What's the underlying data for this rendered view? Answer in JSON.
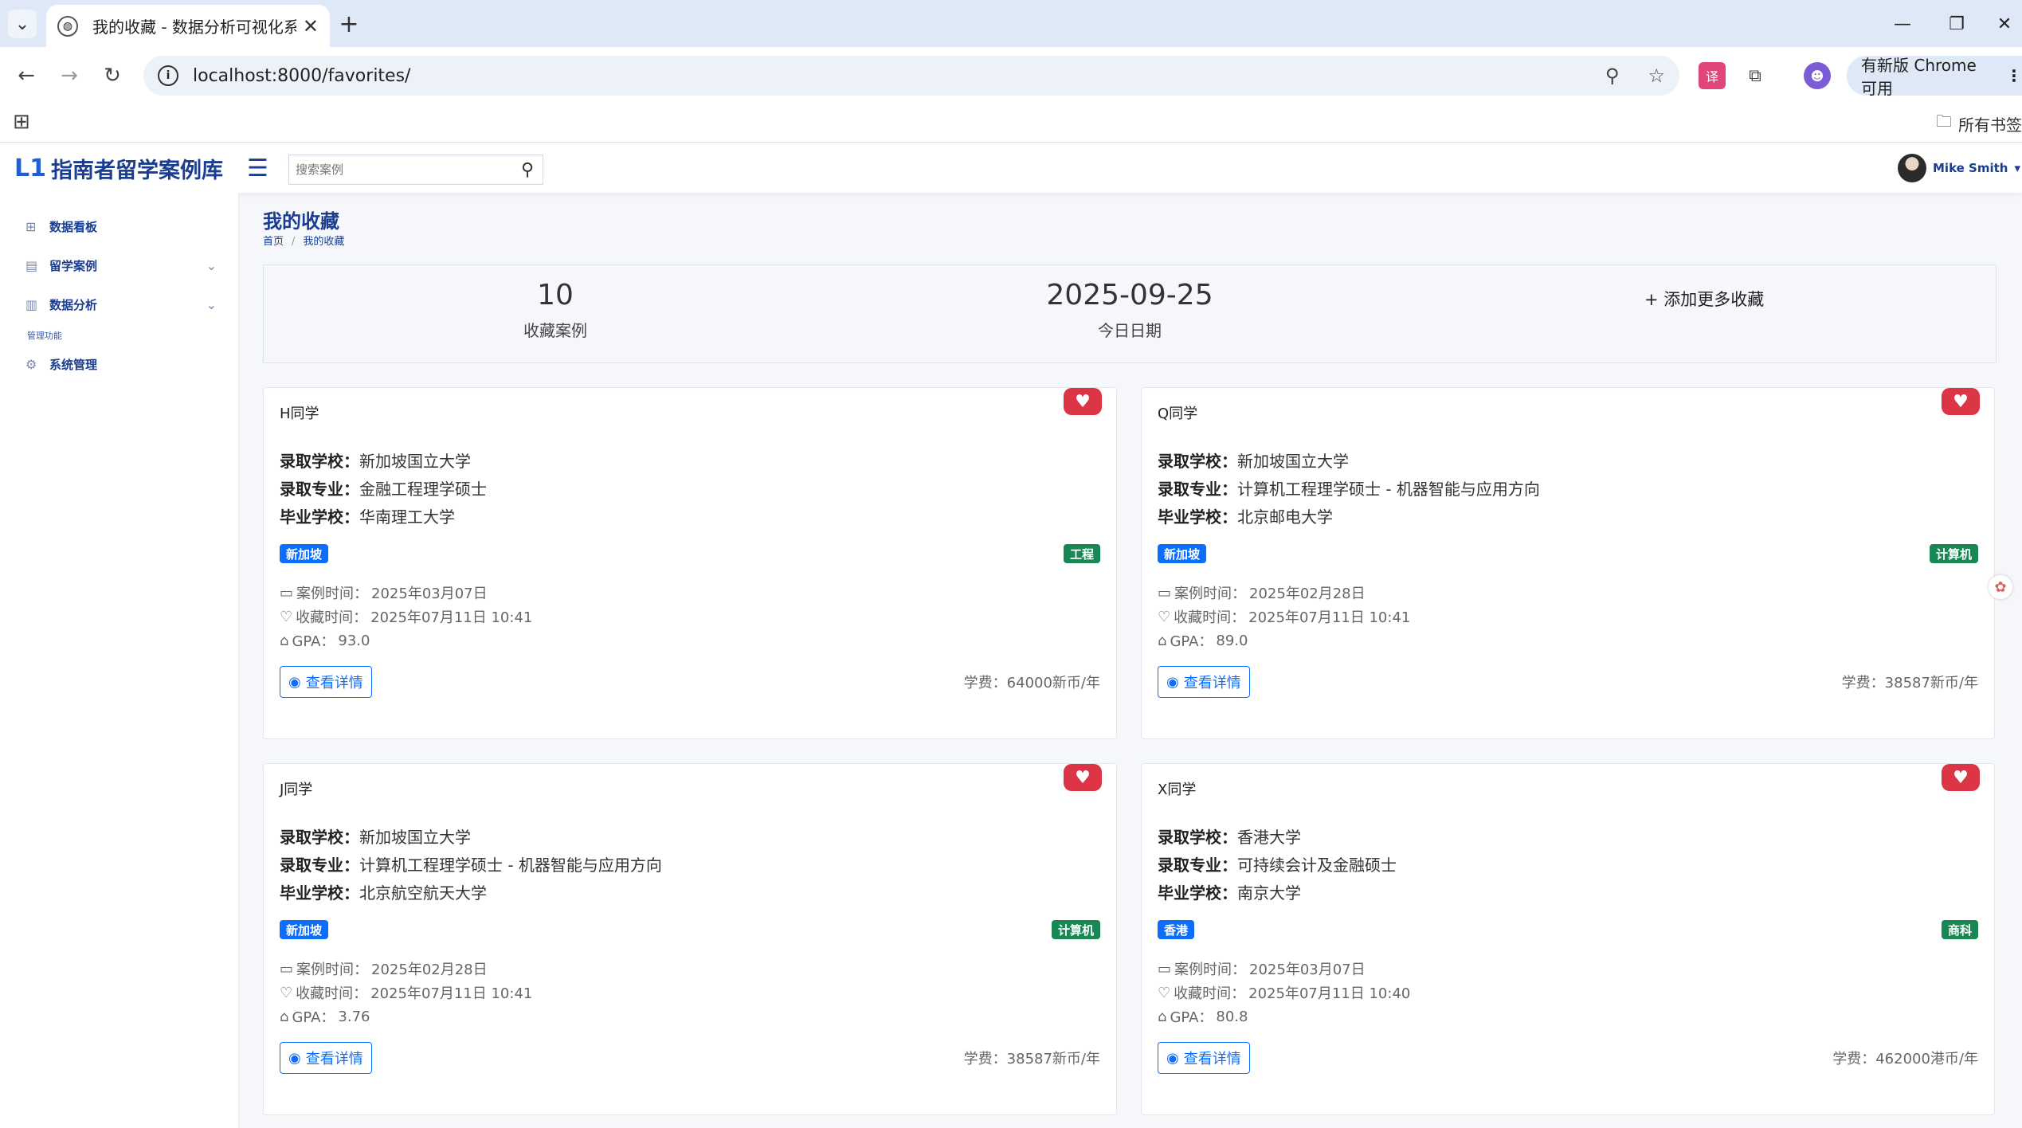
{
  "browser": {
    "tab_title": "我的收藏 - 数据分析可视化系统",
    "url": "localhost:8000/favorites/",
    "update_label": "有新版 Chrome 可用",
    "all_bookmarks": "所有书签"
  },
  "header": {
    "logo_mark": "L1",
    "logo_text": "指南者留学案例库",
    "search_placeholder": "搜索案例",
    "user_name": "Mike Smith",
    "user_caret": "▾"
  },
  "sidebar": {
    "items": [
      {
        "label": "数据看板",
        "icon": "dashboard-icon"
      },
      {
        "label": "留学案例",
        "icon": "document-icon",
        "chevron": "⌄"
      },
      {
        "label": "数据分析",
        "icon": "bar-chart-icon",
        "chevron": "⌄"
      }
    ],
    "category": "管理功能",
    "admin_item": {
      "label": "系统管理",
      "icon": "gear-icon"
    }
  },
  "page": {
    "title": "我的收藏",
    "breadcrumb_home": "首页",
    "breadcrumb_sep": "/",
    "breadcrumb_current": "我的收藏"
  },
  "stats": {
    "count_value": "10",
    "count_label": "收藏案例",
    "date_value": "2025-09-25",
    "date_label": "今日日期",
    "add_more": "+ 添加更多收藏"
  },
  "labels": {
    "school": "录取学校：",
    "major": "录取专业：",
    "grad": "毕业学校：",
    "case_time": "案例时间：",
    "fav_time": "收藏时间：",
    "gpa": "GPA：",
    "detail": "查看详情",
    "fee": "学费："
  },
  "cards": [
    {
      "name": "H同学",
      "school": "新加坡国立大学",
      "major": "金融工程理学硕士",
      "grad": "华南理工大学",
      "region": "新加坡",
      "region_color": "#0d6efd",
      "field": "工程",
      "field_color": "#198754",
      "case_time": "2025年03月07日",
      "fav_time": "2025年07月11日 10:41",
      "gpa": "93.0",
      "fee": "64000新币/年"
    },
    {
      "name": "Q同学",
      "school": "新加坡国立大学",
      "major": "计算机工程理学硕士 - 机器智能与应用方向",
      "grad": "北京邮电大学",
      "region": "新加坡",
      "region_color": "#0d6efd",
      "field": "计算机",
      "field_color": "#198754",
      "case_time": "2025年02月28日",
      "fav_time": "2025年07月11日 10:41",
      "gpa": "89.0",
      "fee": "38587新币/年"
    },
    {
      "name": "J同学",
      "school": "新加坡国立大学",
      "major": "计算机工程理学硕士 - 机器智能与应用方向",
      "grad": "北京航空航天大学",
      "region": "新加坡",
      "region_color": "#0d6efd",
      "field": "计算机",
      "field_color": "#198754",
      "case_time": "2025年02月28日",
      "fav_time": "2025年07月11日 10:41",
      "gpa": "3.76",
      "fee": "38587新币/年"
    },
    {
      "name": "X同学",
      "school": "香港大学",
      "major": "可持续会计及金融硕士",
      "grad": "南京大学",
      "region": "香港",
      "region_color": "#0d6efd",
      "field": "商科",
      "field_color": "#198754",
      "case_time": "2025年03月07日",
      "fav_time": "2025年07月11日 10:40",
      "gpa": "80.8",
      "fee": "462000港币/年"
    }
  ]
}
